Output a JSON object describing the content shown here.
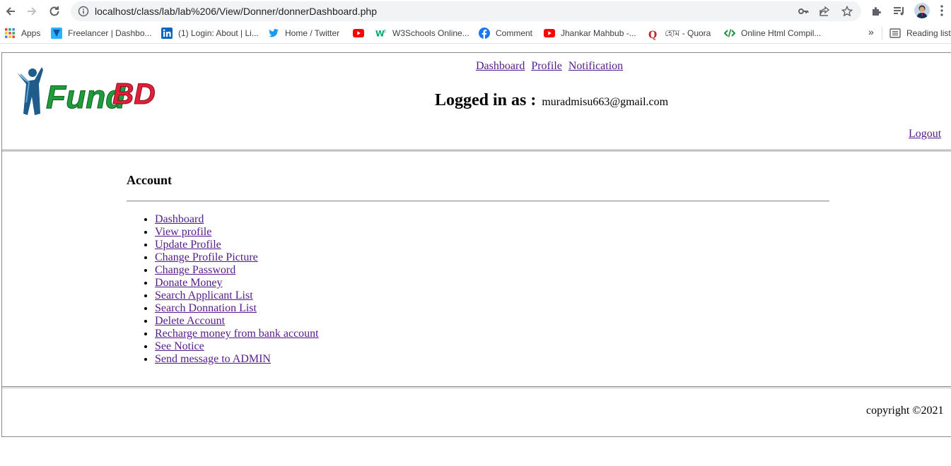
{
  "browser": {
    "url": "localhost/class/lab/lab%206/View/Donner/donnerDashboard.php",
    "bookmarks": [
      {
        "label": "Apps",
        "icon": "apps-grid-icon"
      },
      {
        "label": "Freelancer | Dashbo...",
        "icon": "freelancer-icon"
      },
      {
        "label": "(1) Login: About | Li...",
        "icon": "linkedin-icon"
      },
      {
        "label": "Home / Twitter",
        "icon": "twitter-icon"
      },
      {
        "label": "",
        "icon": "youtube-icon"
      },
      {
        "label": "W3Schools Online...",
        "icon": "w3schools-icon"
      },
      {
        "label": "Comment",
        "icon": "facebook-icon"
      },
      {
        "label": "Jhankar Mahbub -...",
        "icon": "youtube-icon"
      },
      {
        "label": "হোম - Quora",
        "icon": "quora-icon"
      },
      {
        "label": "Online Html Compil...",
        "icon": "code-icon"
      }
    ],
    "overflow_label": "»",
    "reading_list_label": "Reading list"
  },
  "header": {
    "logo_text": "Fund BD",
    "nav_links": [
      "Dashboard",
      "Profile",
      "Notification"
    ],
    "logged_in_label": "Logged in as :",
    "user_email": "muradmisu663@gmail.com",
    "logout_label": "Logout"
  },
  "account": {
    "title": "Account",
    "menu": [
      "Dashboard",
      "View profile",
      "Update Profile",
      "Change Profile Picture",
      "Change Password",
      "Donate Money",
      "Search Applicant List",
      "Search Donnation List",
      "Delete Account",
      "Recharge money from bank account",
      "See Notice",
      "Send message to ADMIN"
    ]
  },
  "footer": {
    "copyright": "copyright ©2021"
  },
  "colors": {
    "link_visited": "#551a8b",
    "logo_blue": "#1f5c8c",
    "logo_green": "#1e9e3a",
    "logo_red": "#e0203a"
  }
}
